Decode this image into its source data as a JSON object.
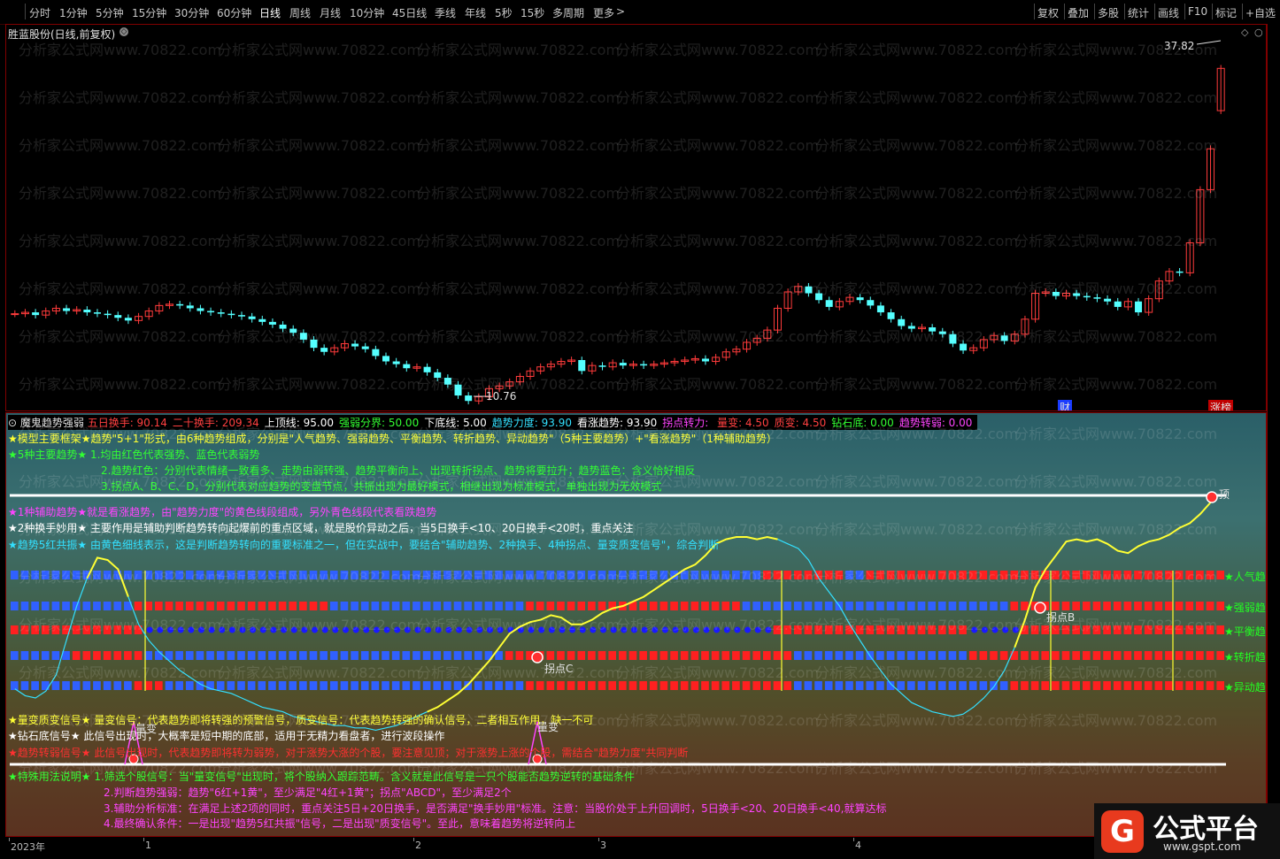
{
  "toolbar": {
    "periods": [
      "分时",
      "1分钟",
      "5分钟",
      "15分钟",
      "30分钟",
      "60分钟",
      "日线",
      "周线",
      "月线",
      "10分钟",
      "45日线",
      "季线",
      "年线",
      "5秒",
      "15秒",
      "多周期",
      "更多"
    ],
    "active": "日线",
    "right_items": [
      "复权",
      "叠加",
      "多股",
      "统计",
      "画线",
      "F10",
      "标记",
      "+自选"
    ]
  },
  "price_panel": {
    "title": "胜蓝股份(日线,前复权)",
    "high_label": "37.82",
    "low_label": "10.76",
    "badge_cai": "财",
    "badge_zhangting": "涨榜",
    "watermark": "分析家公式网www.70822.com"
  },
  "indicator": {
    "name": "魔鬼趋势强弱",
    "params": [
      {
        "label": "五日换手: ",
        "value": "90.14",
        "color": "#ff4040"
      },
      {
        "label": "二十换手: ",
        "value": "209.34",
        "color": "#ff4040"
      },
      {
        "label": "上顶线: ",
        "value": "95.00",
        "color": "#ffffff"
      },
      {
        "label": "强弱分界: ",
        "value": "50.00",
        "color": "#33ff33"
      },
      {
        "label": "下底线: ",
        "value": "5.00",
        "color": "#ffffff"
      },
      {
        "label": "趋势力度: ",
        "value": "93.90",
        "color": "#33e0ff"
      },
      {
        "label": "看涨趋势: ",
        "value": "93.90",
        "color": "#ffffff"
      },
      {
        "label": "拐点转力: ",
        "value": "",
        "color": "#ff44ff"
      },
      {
        "label": "量变: ",
        "value": "4.50",
        "color": "#ff4040"
      },
      {
        "label": "质变: ",
        "value": "4.50",
        "color": "#ff4040"
      },
      {
        "label": "钻石底: ",
        "value": "0.00",
        "color": "#33ff33"
      },
      {
        "label": "趋势转弱: ",
        "value": "0.00",
        "color": "#ff44ff"
      }
    ],
    "legend_top": [
      {
        "text": "★模型主要框架★趋势\"5+1\"形式，由6种趋势组成，分别是\"人气趋势、强弱趋势、平衡趋势、转折趋势、异动趋势\"（5种主要趋势）+\"看涨趋势\"（1种辅助趋势）",
        "color": "#ffff33"
      },
      {
        "text": "★5种主要趋势★ 1.均由红色代表强势、蓝色代表弱势",
        "color": "#33ff33"
      },
      {
        "text": "2.趋势红色：分别代表情绪一致看多、走势由弱转强、趋势平衡向上、出现转折拐点、趋势将要拉升；趋势蓝色：含义恰好相反",
        "color": "#33ff33"
      },
      {
        "text": "3.拐点A、B、C、D，分别代表对应趋势的变盘节点，共振出现为最好模式，相继出现为标准模式，单独出现为无效模式",
        "color": "#33ff33"
      },
      {
        "text": "★1种辅助趋势★就是看涨趋势，由\"趋势力度\"的黄色线段组成，另外青色线段代表看跌趋势",
        "color": "#ff44ff"
      },
      {
        "text": "★2种换手妙用★ 主要作用是辅助判断趋势转向起爆前的重点区域，就是股价异动之后，当5日换手<10、20日换手<20时，重点关注",
        "color": "#ffffff"
      },
      {
        "text": "★趋势5红共振★ 由黄色细线表示，这是判断趋势转向的重要标准之一，但在实战中，要结合\"辅助趋势、2种换手、4种拐点、量变质变信号\"，综合判断",
        "color": "#33e0ff"
      }
    ],
    "legend_bottom": [
      {
        "text": "★量变质变信号★ 量变信号：代表趋势即将转强的预警信号，质变信号：代表趋势转强的确认信号，二者相互作用，缺一不可",
        "color": "#ffff33"
      },
      {
        "text": "★钻石底信号★ 此信号出现时，大概率是短中期的底部，适用于无精力看盘者，进行波段操作",
        "color": "#ffffff"
      },
      {
        "text": "★趋势转弱信号★ 此信号出现时，代表趋势即将转为弱势，对于涨势大涨的个股，要注意见顶；对于涨势上涨的个股，需结合\"趋势力度\"共同判断",
        "color": "#ff3030"
      },
      {
        "text": "★特殊用法说明★ 1.筛选个股信号：当\"量变信号\"出现时，将个股纳入跟踪范畴。含义就是此信号是一只个股能否趋势逆转的基础条件",
        "color": "#33ff33"
      },
      {
        "text": "2.判断趋势强弱：趋势\"6红+1黄\"，至少满足\"4红+1黄\"；拐点\"ABCD\"，至少满足2个",
        "color": "#ff44ff"
      },
      {
        "text": "3.辅助分析标准：在满足上述2项的同时，重点关注5日+20日换手，是否满足\"换手妙用\"标准。注意：当股价处于上升回调时，5日换手<20、20日换手<40,就算达标",
        "color": "#ff44ff"
      },
      {
        "text": "4.最终确认条件：一是出现\"趋势5红共振\"信号，二是出现\"质变信号\"。至此，意味着趋势将逆转向上",
        "color": "#ff44ff"
      }
    ],
    "row_labels": [
      "人气趋势",
      "强弱趋势",
      "平衡趋势",
      "转折趋势",
      "异动趋势"
    ],
    "markers": {
      "top": "顶",
      "b": "拐点B",
      "c": "拐点C",
      "vol1": "量变",
      "vol2": "量变"
    }
  },
  "xaxis": {
    "labels": [
      "2023年",
      "1",
      "2",
      "3",
      "4"
    ]
  },
  "logo": {
    "text": "公式平台",
    "url": "www.gspt.com"
  },
  "colors": {
    "up": "#ff3b3b",
    "down": "#54ffff",
    "yellow": "#ffff33",
    "cyan": "#33e0ff",
    "red_block": "#ff2020",
    "blue_block": "#3060ff",
    "white": "#ffffff",
    "green": "#22ff22"
  },
  "candles": {
    "close": [
      17.4,
      17.5,
      17.3,
      17.6,
      17.8,
      17.6,
      17.7,
      17.5,
      17.4,
      17.3,
      17.1,
      16.9,
      17.2,
      17.6,
      18.0,
      18.1,
      18.0,
      17.8,
      17.6,
      17.5,
      17.4,
      17.3,
      17.2,
      17.0,
      16.8,
      16.6,
      16.3,
      16.0,
      15.5,
      14.9,
      14.6,
      14.9,
      15.2,
      15.0,
      14.8,
      14.3,
      13.9,
      13.7,
      13.4,
      13.5,
      13.1,
      12.7,
      12.2,
      11.4,
      11.0,
      11.3,
      11.9,
      12.1,
      12.4,
      12.8,
      13.2,
      13.5,
      13.7,
      13.9,
      14.0,
      13.2,
      13.6,
      13.5,
      13.8,
      13.6,
      13.7,
      13.6,
      13.7,
      13.8,
      13.9,
      14.0,
      14.1,
      13.9,
      14.2,
      14.6,
      14.8,
      15.3,
      15.6,
      16.2,
      17.8,
      19.0,
      19.4,
      18.9,
      18.4,
      17.9,
      18.3,
      18.6,
      18.4,
      18.0,
      17.5,
      17.0,
      16.5,
      16.3,
      16.4,
      16.1,
      15.9,
      15.2,
      14.7,
      14.9,
      15.5,
      15.8,
      15.4,
      15.9,
      17.0,
      18.9,
      19.0,
      18.7,
      18.9,
      18.7,
      18.6,
      18.5,
      18.3,
      17.9,
      18.3,
      17.5,
      18.5,
      19.8,
      20.5,
      20.4,
      22.6,
      26.5,
      29.5,
      35.4
    ],
    "open": [
      17.4,
      17.4,
      17.5,
      17.3,
      17.6,
      17.8,
      17.6,
      17.7,
      17.5,
      17.4,
      17.3,
      17.1,
      16.9,
      17.2,
      17.6,
      18.0,
      18.1,
      18.0,
      17.8,
      17.6,
      17.5,
      17.4,
      17.3,
      17.2,
      17.0,
      16.8,
      16.6,
      16.3,
      16.0,
      15.5,
      14.9,
      14.6,
      14.9,
      15.2,
      15.0,
      14.8,
      14.3,
      13.9,
      13.7,
      13.4,
      13.5,
      13.1,
      12.7,
      12.2,
      11.4,
      11.0,
      11.3,
      11.9,
      12.1,
      12.4,
      12.8,
      13.2,
      13.5,
      13.7,
      13.9,
      14.0,
      13.2,
      13.6,
      13.5,
      13.8,
      13.6,
      13.7,
      13.6,
      13.7,
      13.8,
      13.9,
      14.0,
      14.1,
      13.9,
      14.2,
      14.6,
      14.8,
      15.3,
      15.6,
      16.2,
      17.8,
      19.0,
      19.4,
      18.9,
      18.4,
      17.9,
      18.3,
      18.6,
      18.4,
      18.0,
      17.5,
      17.0,
      16.5,
      16.3,
      16.4,
      16.1,
      15.9,
      15.2,
      14.7,
      14.9,
      15.5,
      15.8,
      15.4,
      15.9,
      17.0,
      18.9,
      19.0,
      18.7,
      18.9,
      18.7,
      18.6,
      18.5,
      18.3,
      17.9,
      18.3,
      17.5,
      18.5,
      19.8,
      20.5,
      20.4,
      22.6,
      26.5,
      32.3
    ],
    "price_top": 38.6,
    "price_bottom": 10.3
  },
  "trend_line": {
    "values": [
      34,
      31,
      30,
      33,
      40,
      55,
      70,
      82,
      91,
      90,
      86,
      74,
      62,
      55,
      50,
      46,
      42,
      39,
      36,
      34,
      33,
      32,
      30,
      28,
      26,
      25,
      24,
      22,
      21,
      20,
      19,
      18,
      18,
      17,
      17,
      16,
      17,
      18,
      20,
      22,
      24,
      26,
      29,
      32,
      36,
      41,
      46,
      52,
      58,
      61,
      63,
      64,
      66,
      65,
      62,
      62,
      64,
      67,
      69,
      70,
      72,
      74,
      77,
      80,
      83,
      86,
      88,
      92,
      97,
      99,
      100,
      100,
      99,
      100,
      99,
      97,
      95,
      90,
      82,
      76,
      70,
      62,
      55,
      48,
      42,
      36,
      32,
      28,
      26,
      24,
      23,
      22,
      23,
      26,
      30,
      35,
      42,
      52,
      64,
      78,
      86,
      92,
      98,
      99,
      98,
      99,
      97,
      94,
      93,
      96,
      98,
      99,
      101,
      104,
      106,
      110,
      115,
      122
    ],
    "color_split": [
      [
        0,
        7,
        "cyan"
      ],
      [
        7,
        11,
        "yellow"
      ],
      [
        11,
        40,
        "cyan"
      ],
      [
        40,
        74,
        "yellow"
      ],
      [
        74,
        97,
        "cyan"
      ],
      [
        97,
        116,
        "yellow"
      ]
    ],
    "ymax": 125,
    "ymin": 0
  }
}
